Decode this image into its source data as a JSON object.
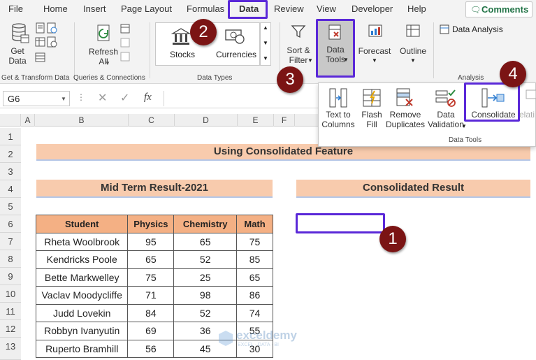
{
  "menu": {
    "items": [
      "File",
      "Home",
      "Insert",
      "Page Layout",
      "Formulas",
      "Data",
      "Review",
      "View",
      "Developer",
      "Help"
    ],
    "active": "Data",
    "comments_label": "Comments"
  },
  "ribbon": {
    "get_data": "Get\nData",
    "refresh_all": "Refresh\nAll",
    "stocks": "Stocks",
    "currencies": "Currencies",
    "sort_filter": "Sort &\nFilter",
    "data_tools": "Data\nTools",
    "forecast": "Forecast",
    "outline": "Outline",
    "data_analysis": "Data Analysis",
    "groups": {
      "get_transform": "Get & Transform Data",
      "queries": "Queries & Connections",
      "data_types": "Data Types",
      "analysis": "Analysis"
    }
  },
  "dropdown": {
    "text_to_columns": "Text to\nColumns",
    "flash_fill": "Flash\nFill",
    "remove_duplicates": "Remove\nDuplicates",
    "data_validation": "Data\nValidation",
    "consolidate": "Consolidate",
    "relationships_partial": "elati",
    "group_label": "Data Tools"
  },
  "formula_bar": {
    "name_box": "G6",
    "fx": "fx"
  },
  "columns": [
    "A",
    "B",
    "C",
    "D",
    "E",
    "F"
  ],
  "rows": [
    "1",
    "2",
    "3",
    "4",
    "5",
    "6",
    "7",
    "8",
    "9",
    "10",
    "11",
    "12",
    "13"
  ],
  "sheet": {
    "title": "Using Consolidated Feature",
    "left_header": "Mid Term Result-2021",
    "right_header": "Consolidated Result",
    "table": {
      "headers": [
        "Student",
        "Physics",
        "Chemistry",
        "Math"
      ],
      "rows": [
        [
          "Rheta Woolbrook",
          "95",
          "65",
          "75"
        ],
        [
          "Kendricks Poole",
          "65",
          "52",
          "85"
        ],
        [
          "Bette Markwelley",
          "75",
          "25",
          "65"
        ],
        [
          "Vaclav Moodycliffe",
          "71",
          "98",
          "86"
        ],
        [
          "Judd Lovekin",
          "84",
          "52",
          "74"
        ],
        [
          "Robbyn Ivanyutin",
          "69",
          "36",
          "55"
        ],
        [
          "Ruperto Bramhill",
          "56",
          "45",
          "30"
        ]
      ]
    }
  },
  "badges": [
    "1",
    "2",
    "3",
    "4"
  ],
  "watermark": {
    "name": "exceldemy",
    "tagline": "EXCEL · DATA · BI"
  },
  "colors": {
    "header_fill": "#f8cbad",
    "table_header_fill": "#f4b084",
    "badge": "#7b1414",
    "highlight": "#5a28d8"
  }
}
